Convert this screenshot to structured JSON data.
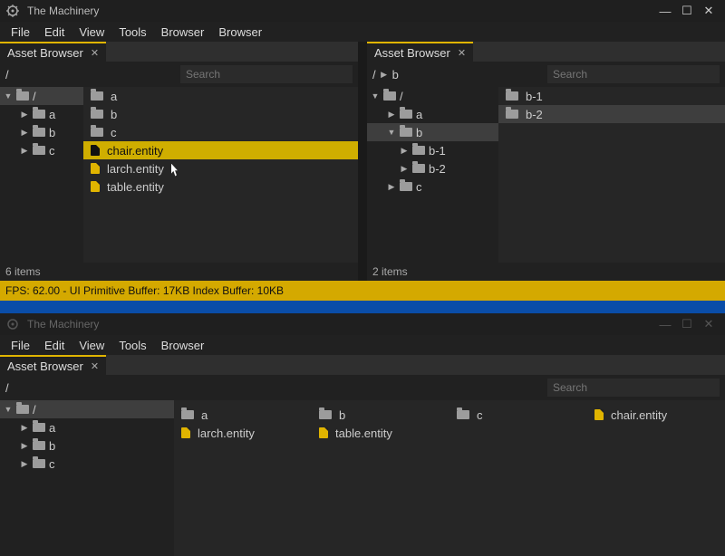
{
  "app_title": "The Machinery",
  "menu1": {
    "file": "File",
    "edit": "Edit",
    "view": "View",
    "tools": "Tools",
    "browser": "Browser",
    "extra_browser": "Browser"
  },
  "menu2": {
    "file": "File",
    "edit": "Edit",
    "view": "View",
    "tools": "Tools",
    "browser": "Browser"
  },
  "tab_title": "Asset Browser",
  "search_placeholder": "Search",
  "pane_left": {
    "path": "/",
    "tree": [
      {
        "label": "/",
        "kind": "folder",
        "expanded": true,
        "selected": true,
        "depth": 0
      },
      {
        "label": "a",
        "kind": "folder",
        "expanded": false,
        "depth": 1
      },
      {
        "label": "b",
        "kind": "folder",
        "expanded": false,
        "depth": 1
      },
      {
        "label": "c",
        "kind": "folder",
        "expanded": false,
        "depth": 1
      }
    ],
    "content": [
      {
        "label": "a",
        "kind": "folder"
      },
      {
        "label": "b",
        "kind": "folder"
      },
      {
        "label": "c",
        "kind": "folder"
      },
      {
        "label": "chair.entity",
        "kind": "file",
        "selected": true
      },
      {
        "label": "larch.entity",
        "kind": "file",
        "cursor": true
      },
      {
        "label": "table.entity",
        "kind": "file"
      }
    ],
    "status": "6 items"
  },
  "pane_right": {
    "path_parts": [
      "/",
      "b"
    ],
    "tree": [
      {
        "label": "/",
        "kind": "folder",
        "expanded": true,
        "depth": 0
      },
      {
        "label": "a",
        "kind": "folder",
        "expanded": false,
        "depth": 1
      },
      {
        "label": "b",
        "kind": "folder",
        "expanded": true,
        "selected": true,
        "depth": 1
      },
      {
        "label": "b-1",
        "kind": "folder",
        "expanded": false,
        "depth": 2
      },
      {
        "label": "b-2",
        "kind": "folder",
        "expanded": false,
        "depth": 2
      },
      {
        "label": "c",
        "kind": "folder",
        "expanded": false,
        "depth": 1
      }
    ],
    "content": [
      {
        "label": "b-1",
        "kind": "folder"
      },
      {
        "label": "b-2",
        "kind": "folder",
        "hover": true
      }
    ],
    "status": "2 items"
  },
  "perf_text": "FPS: 62.00 - UI Primitive Buffer: 17KB Index Buffer: 10KB",
  "win2": {
    "path": "/",
    "tree": [
      {
        "label": "/",
        "kind": "folder",
        "expanded": true,
        "selected": true,
        "depth": 0
      },
      {
        "label": "a",
        "kind": "folder",
        "expanded": false,
        "depth": 1
      },
      {
        "label": "b",
        "kind": "folder",
        "expanded": false,
        "depth": 1
      },
      {
        "label": "c",
        "kind": "folder",
        "expanded": false,
        "depth": 1
      }
    ],
    "grid": [
      [
        {
          "label": "a",
          "kind": "folder"
        },
        {
          "label": "b",
          "kind": "folder"
        },
        {
          "label": "c",
          "kind": "folder"
        },
        {
          "label": "chair.entity",
          "kind": "file"
        }
      ],
      [
        {
          "label": "larch.entity",
          "kind": "file"
        },
        {
          "label": "table.entity",
          "kind": "file"
        }
      ]
    ]
  }
}
